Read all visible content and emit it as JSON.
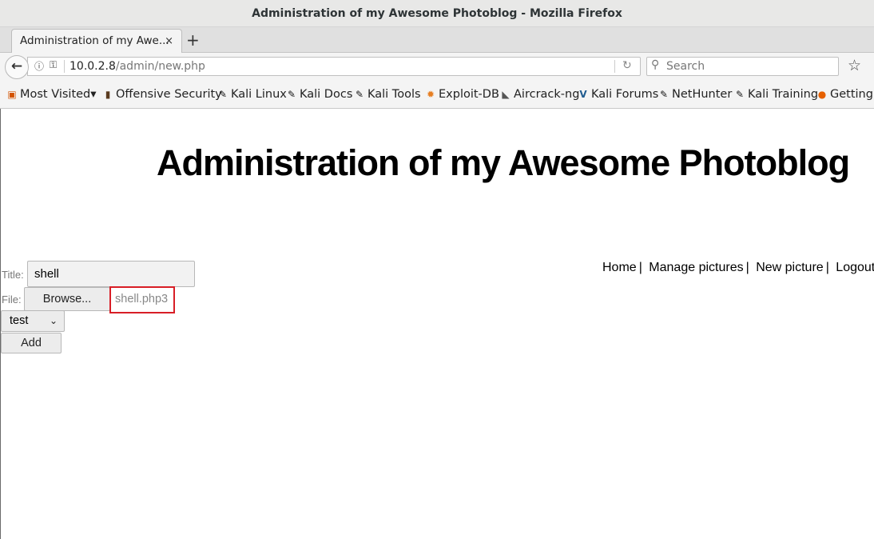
{
  "window": {
    "title": "Administration of my Awesome Photoblog - Mozilla Firefox"
  },
  "tabs": [
    {
      "label": "Administration of my Awe...",
      "close": "×"
    }
  ],
  "newtab_symbol": "+",
  "navbar": {
    "back_symbol": "←",
    "url_host": "10.0.2.8",
    "url_path": "/admin/new.php",
    "reload_symbol": "↻",
    "search_placeholder": "Search",
    "icons": [
      "info-icon",
      "key-icon",
      "reload-icon",
      "search-icon",
      "star-icon"
    ]
  },
  "bookmarks": [
    {
      "label": "Most Visited",
      "icon": "most-visited-icon",
      "dropdown": "▾"
    },
    {
      "label": "Offensive Security",
      "icon": "offensive-security-icon"
    },
    {
      "label": "Kali Linux",
      "icon": "kali-icon"
    },
    {
      "label": "Kali Docs",
      "icon": "kali-icon"
    },
    {
      "label": "Kali Tools",
      "icon": "kali-icon"
    },
    {
      "label": "Exploit-DB",
      "icon": "exploit-db-icon"
    },
    {
      "label": "Aircrack-ng",
      "icon": "aircrack-icon"
    },
    {
      "label": "Kali Forums",
      "icon": "forums-icon"
    },
    {
      "label": "NetHunter",
      "icon": "kali-icon"
    },
    {
      "label": "Kali Training",
      "icon": "kali-icon"
    },
    {
      "label": "Getting Started",
      "icon": "firefox-icon"
    }
  ],
  "page": {
    "heading": "Administration of my Awesome Photoblog",
    "nav": {
      "home": "Home",
      "manage": "Manage pictures",
      "new": "New picture",
      "logout": "Logout",
      "sep": "|"
    },
    "form": {
      "title_label": "Title:",
      "title_value": "shell",
      "file_label": "File:",
      "browse_label": "Browse...",
      "file_name": "shell.php3",
      "category_selected": "test",
      "add_label": "Add"
    },
    "highlight_color": "#d81e26"
  }
}
